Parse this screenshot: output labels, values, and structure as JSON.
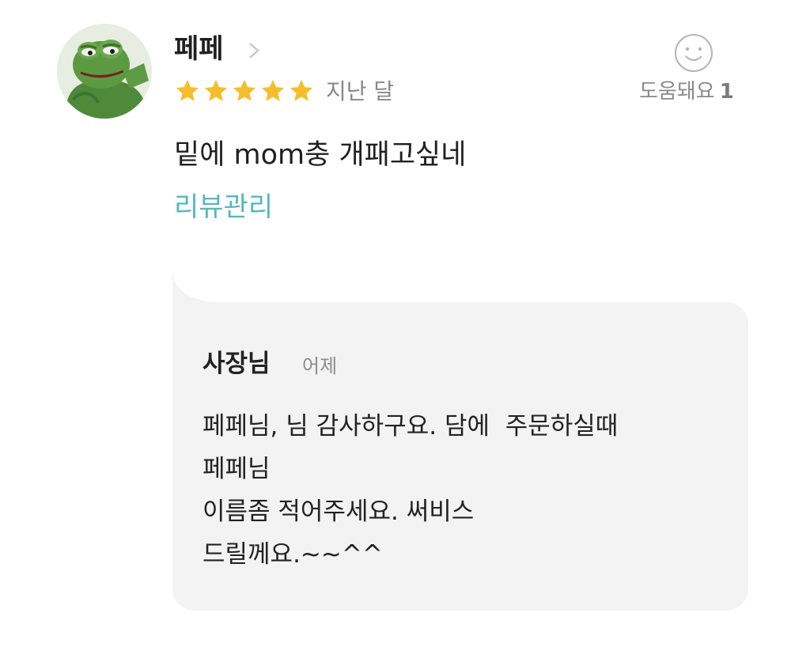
{
  "review": {
    "reviewer_name": "페페",
    "rating": 5,
    "date": "지난 달",
    "text": "밑에 mom충 개패고싶네",
    "manage_label": "리뷰관리",
    "helpful_label": "도움돼요",
    "helpful_count": "1"
  },
  "reply": {
    "owner_name": "사장님",
    "date": "어제",
    "lines": [
      "페페님, 님 감사하구요. 담에  주문하실때",
      "페페님",
      "이름좀 적어주세요. 써비스",
      "드릴께요.~~^^"
    ]
  },
  "icons": {
    "chevron": "chevron-right-icon",
    "helpful": "smiley-icon",
    "star": "star-icon",
    "avatar": "frog-avatar"
  },
  "colors": {
    "star": "#f6bd2b",
    "link": "#55b8bc",
    "reply_bg": "#f3f3f3",
    "muted": "#888888"
  }
}
